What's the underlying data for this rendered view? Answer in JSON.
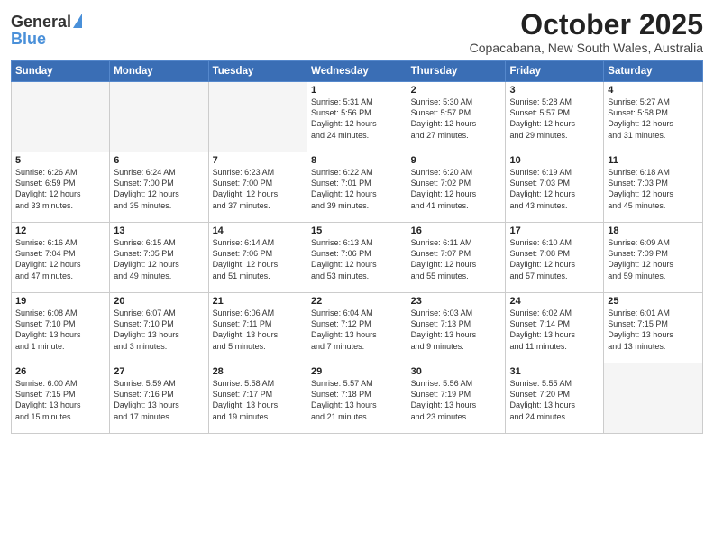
{
  "header": {
    "logo_general": "General",
    "logo_blue": "Blue",
    "month": "October 2025",
    "location": "Copacabana, New South Wales, Australia"
  },
  "weekdays": [
    "Sunday",
    "Monday",
    "Tuesday",
    "Wednesday",
    "Thursday",
    "Friday",
    "Saturday"
  ],
  "weeks": [
    [
      {
        "day": "",
        "info": ""
      },
      {
        "day": "",
        "info": ""
      },
      {
        "day": "",
        "info": ""
      },
      {
        "day": "1",
        "info": "Sunrise: 5:31 AM\nSunset: 5:56 PM\nDaylight: 12 hours\nand 24 minutes."
      },
      {
        "day": "2",
        "info": "Sunrise: 5:30 AM\nSunset: 5:57 PM\nDaylight: 12 hours\nand 27 minutes."
      },
      {
        "day": "3",
        "info": "Sunrise: 5:28 AM\nSunset: 5:57 PM\nDaylight: 12 hours\nand 29 minutes."
      },
      {
        "day": "4",
        "info": "Sunrise: 5:27 AM\nSunset: 5:58 PM\nDaylight: 12 hours\nand 31 minutes."
      }
    ],
    [
      {
        "day": "5",
        "info": "Sunrise: 6:26 AM\nSunset: 6:59 PM\nDaylight: 12 hours\nand 33 minutes."
      },
      {
        "day": "6",
        "info": "Sunrise: 6:24 AM\nSunset: 7:00 PM\nDaylight: 12 hours\nand 35 minutes."
      },
      {
        "day": "7",
        "info": "Sunrise: 6:23 AM\nSunset: 7:00 PM\nDaylight: 12 hours\nand 37 minutes."
      },
      {
        "day": "8",
        "info": "Sunrise: 6:22 AM\nSunset: 7:01 PM\nDaylight: 12 hours\nand 39 minutes."
      },
      {
        "day": "9",
        "info": "Sunrise: 6:20 AM\nSunset: 7:02 PM\nDaylight: 12 hours\nand 41 minutes."
      },
      {
        "day": "10",
        "info": "Sunrise: 6:19 AM\nSunset: 7:03 PM\nDaylight: 12 hours\nand 43 minutes."
      },
      {
        "day": "11",
        "info": "Sunrise: 6:18 AM\nSunset: 7:03 PM\nDaylight: 12 hours\nand 45 minutes."
      }
    ],
    [
      {
        "day": "12",
        "info": "Sunrise: 6:16 AM\nSunset: 7:04 PM\nDaylight: 12 hours\nand 47 minutes."
      },
      {
        "day": "13",
        "info": "Sunrise: 6:15 AM\nSunset: 7:05 PM\nDaylight: 12 hours\nand 49 minutes."
      },
      {
        "day": "14",
        "info": "Sunrise: 6:14 AM\nSunset: 7:06 PM\nDaylight: 12 hours\nand 51 minutes."
      },
      {
        "day": "15",
        "info": "Sunrise: 6:13 AM\nSunset: 7:06 PM\nDaylight: 12 hours\nand 53 minutes."
      },
      {
        "day": "16",
        "info": "Sunrise: 6:11 AM\nSunset: 7:07 PM\nDaylight: 12 hours\nand 55 minutes."
      },
      {
        "day": "17",
        "info": "Sunrise: 6:10 AM\nSunset: 7:08 PM\nDaylight: 12 hours\nand 57 minutes."
      },
      {
        "day": "18",
        "info": "Sunrise: 6:09 AM\nSunset: 7:09 PM\nDaylight: 12 hours\nand 59 minutes."
      }
    ],
    [
      {
        "day": "19",
        "info": "Sunrise: 6:08 AM\nSunset: 7:10 PM\nDaylight: 13 hours\nand 1 minute."
      },
      {
        "day": "20",
        "info": "Sunrise: 6:07 AM\nSunset: 7:10 PM\nDaylight: 13 hours\nand 3 minutes."
      },
      {
        "day": "21",
        "info": "Sunrise: 6:06 AM\nSunset: 7:11 PM\nDaylight: 13 hours\nand 5 minutes."
      },
      {
        "day": "22",
        "info": "Sunrise: 6:04 AM\nSunset: 7:12 PM\nDaylight: 13 hours\nand 7 minutes."
      },
      {
        "day": "23",
        "info": "Sunrise: 6:03 AM\nSunset: 7:13 PM\nDaylight: 13 hours\nand 9 minutes."
      },
      {
        "day": "24",
        "info": "Sunrise: 6:02 AM\nSunset: 7:14 PM\nDaylight: 13 hours\nand 11 minutes."
      },
      {
        "day": "25",
        "info": "Sunrise: 6:01 AM\nSunset: 7:15 PM\nDaylight: 13 hours\nand 13 minutes."
      }
    ],
    [
      {
        "day": "26",
        "info": "Sunrise: 6:00 AM\nSunset: 7:15 PM\nDaylight: 13 hours\nand 15 minutes."
      },
      {
        "day": "27",
        "info": "Sunrise: 5:59 AM\nSunset: 7:16 PM\nDaylight: 13 hours\nand 17 minutes."
      },
      {
        "day": "28",
        "info": "Sunrise: 5:58 AM\nSunset: 7:17 PM\nDaylight: 13 hours\nand 19 minutes."
      },
      {
        "day": "29",
        "info": "Sunrise: 5:57 AM\nSunset: 7:18 PM\nDaylight: 13 hours\nand 21 minutes."
      },
      {
        "day": "30",
        "info": "Sunrise: 5:56 AM\nSunset: 7:19 PM\nDaylight: 13 hours\nand 23 minutes."
      },
      {
        "day": "31",
        "info": "Sunrise: 5:55 AM\nSunset: 7:20 PM\nDaylight: 13 hours\nand 24 minutes."
      },
      {
        "day": "",
        "info": ""
      }
    ]
  ]
}
